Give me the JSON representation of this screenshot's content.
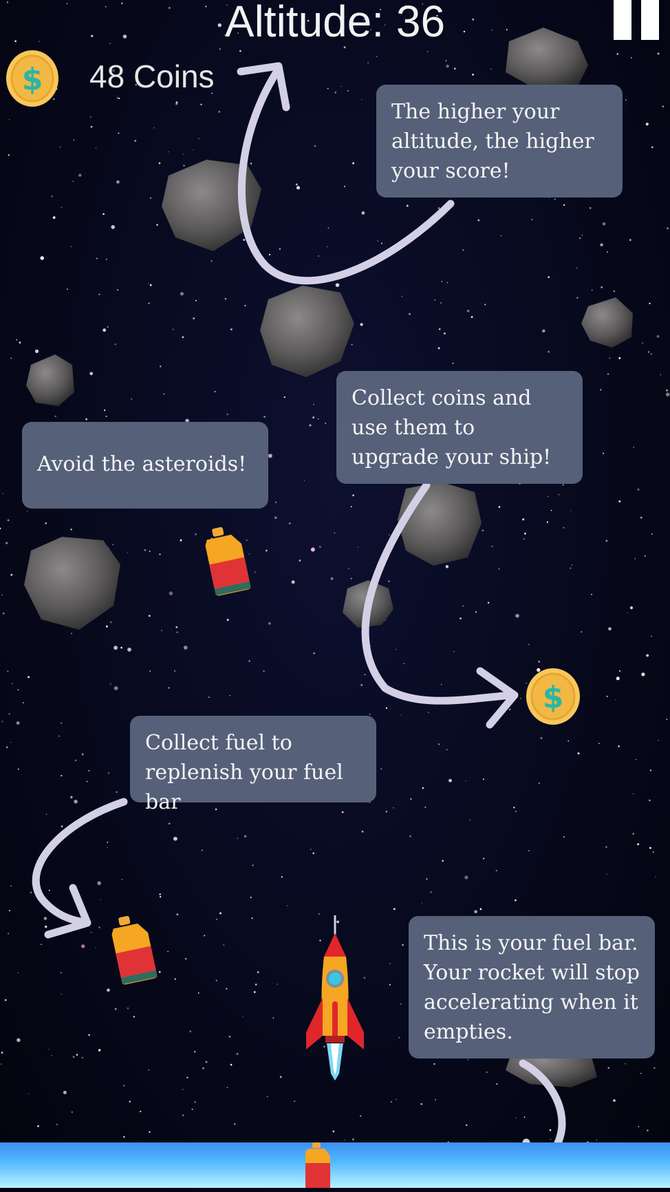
{
  "hud": {
    "altitude_label": "Altitude: 36",
    "coins_label": "48 Coins",
    "pause_icon": "pause-icon",
    "coin_icon": "coin-icon"
  },
  "tutorial": {
    "altitude_tip": "The higher your altitude, the higher your score!",
    "asteroid_tip": "Avoid the asteroids!",
    "coins_tip": "Collect coins and use them to upgrade your ship!",
    "fuel_tip": "Collect fuel to replenish your fuel bar",
    "fuelbar_tip": "This is your fuel bar. Your rocket will stop accelerating when it empties."
  },
  "fuel_bar": {
    "level": 1.0,
    "icon": "fuel-can-icon"
  },
  "colors": {
    "tip_background": "#566079",
    "arrow": "#d3d0e6",
    "coin": "#f2c14e",
    "coin_symbol": "#2bb5a8",
    "fuel_bar": "#4fb6ff"
  }
}
